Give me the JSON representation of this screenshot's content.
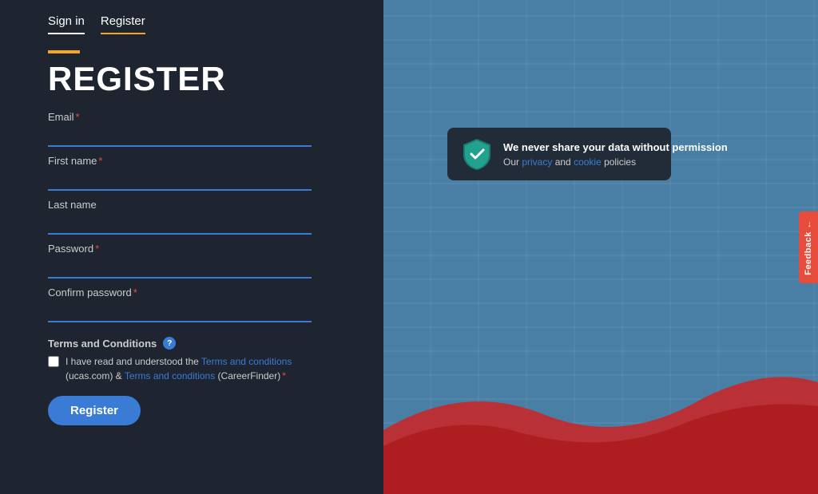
{
  "nav": {
    "signin_label": "Sign in",
    "register_label": "Register"
  },
  "page": {
    "title": "REGISTER",
    "title_bar_color": "#f5a623"
  },
  "form": {
    "email_label": "Email",
    "firstname_label": "First name",
    "lastname_label": "Last name",
    "password_label": "Password",
    "confirm_password_label": "Confirm password",
    "email_placeholder": "",
    "firstname_placeholder": "",
    "lastname_placeholder": "",
    "password_placeholder": "",
    "confirm_password_placeholder": ""
  },
  "terms": {
    "section_title": "Terms and Conditions",
    "checkbox_text_prefix": "I have read and understood the ",
    "ucas_link_text": "Terms and conditions",
    "ucas_link_suffix": " (ucas.com) & ",
    "cf_link_text": "Terms and conditions",
    "cf_link_suffix": " (CareerFinder)",
    "required_marker": "*"
  },
  "buttons": {
    "register_label": "Register"
  },
  "privacy": {
    "title": "We never share your data without permission",
    "subtitle_prefix": "Our ",
    "privacy_link": "privacy",
    "middle_text": " and ",
    "cookie_link": "cookie",
    "subtitle_suffix": " policies"
  },
  "feedback": {
    "label": "Feedback ←"
  }
}
